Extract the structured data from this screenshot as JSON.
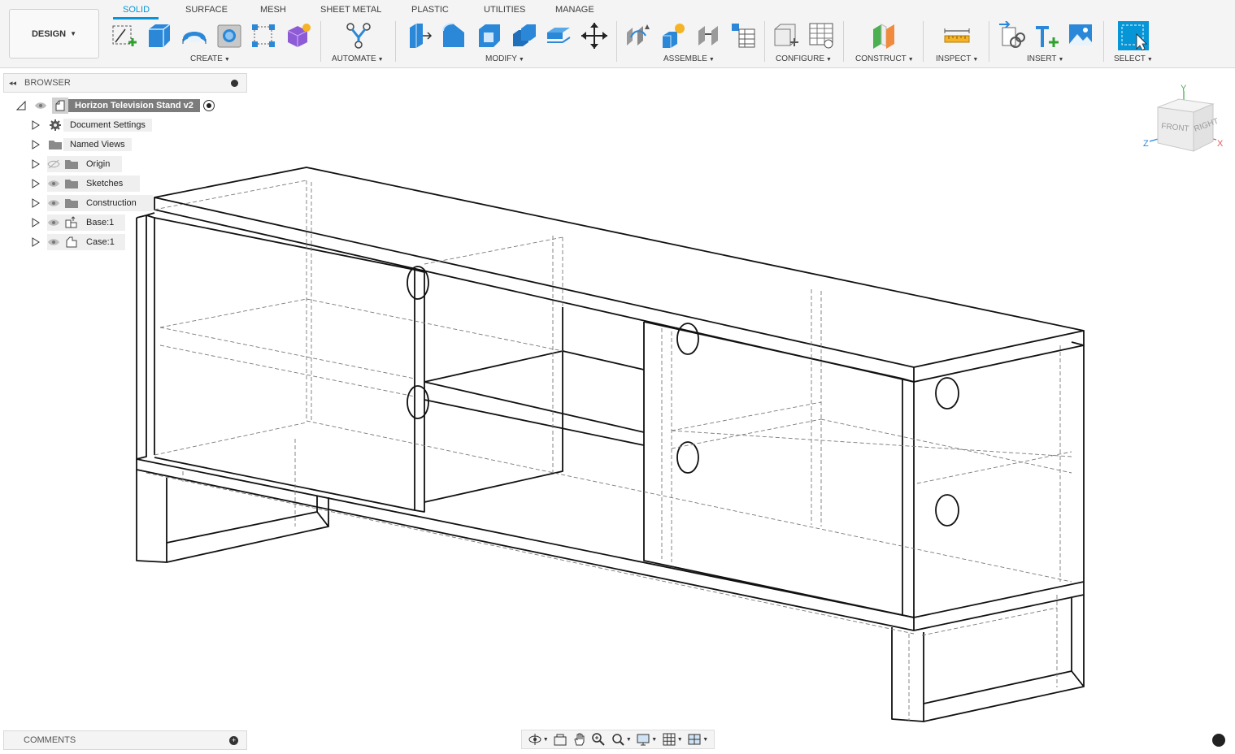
{
  "workspace": {
    "label": "DESIGN"
  },
  "tabs": [
    {
      "label": "SOLID",
      "active": true
    },
    {
      "label": "SURFACE",
      "active": false
    },
    {
      "label": "MESH",
      "active": false
    },
    {
      "label": "SHEET METAL",
      "active": false
    },
    {
      "label": "PLASTIC",
      "active": false
    },
    {
      "label": "UTILITIES",
      "active": false
    },
    {
      "label": "MANAGE",
      "active": false
    }
  ],
  "toolbar_groups": [
    {
      "label": "CREATE"
    },
    {
      "label": "AUTOMATE"
    },
    {
      "label": "MODIFY"
    },
    {
      "label": "ASSEMBLE"
    },
    {
      "label": "CONFIGURE"
    },
    {
      "label": "CONSTRUCT"
    },
    {
      "label": "INSPECT"
    },
    {
      "label": "INSERT"
    },
    {
      "label": "SELECT"
    }
  ],
  "browser": {
    "title": "BROWSER",
    "root": {
      "label": "Horizon Television Stand v2"
    },
    "items": [
      {
        "label": "Document Settings",
        "icon": "gear-icon"
      },
      {
        "label": "Named Views",
        "icon": "folder-icon"
      },
      {
        "label": "Origin",
        "icon": "folder-icon",
        "hidden": true
      },
      {
        "label": "Sketches",
        "icon": "folder-icon"
      },
      {
        "label": "Construction",
        "icon": "folder-icon"
      },
      {
        "label": "Base:1",
        "icon": "component-icon"
      },
      {
        "label": "Case:1",
        "icon": "component-icon"
      }
    ]
  },
  "comments": {
    "title": "COMMENTS"
  },
  "viewcube": {
    "front": "FRONT",
    "right": "RIGHT",
    "axis_x": "X",
    "axis_y": "Y",
    "axis_z": "Z"
  },
  "colors": {
    "accent": "#0696d7",
    "toolbar_bg": "#f4f4f4",
    "model_line": "#111111"
  }
}
